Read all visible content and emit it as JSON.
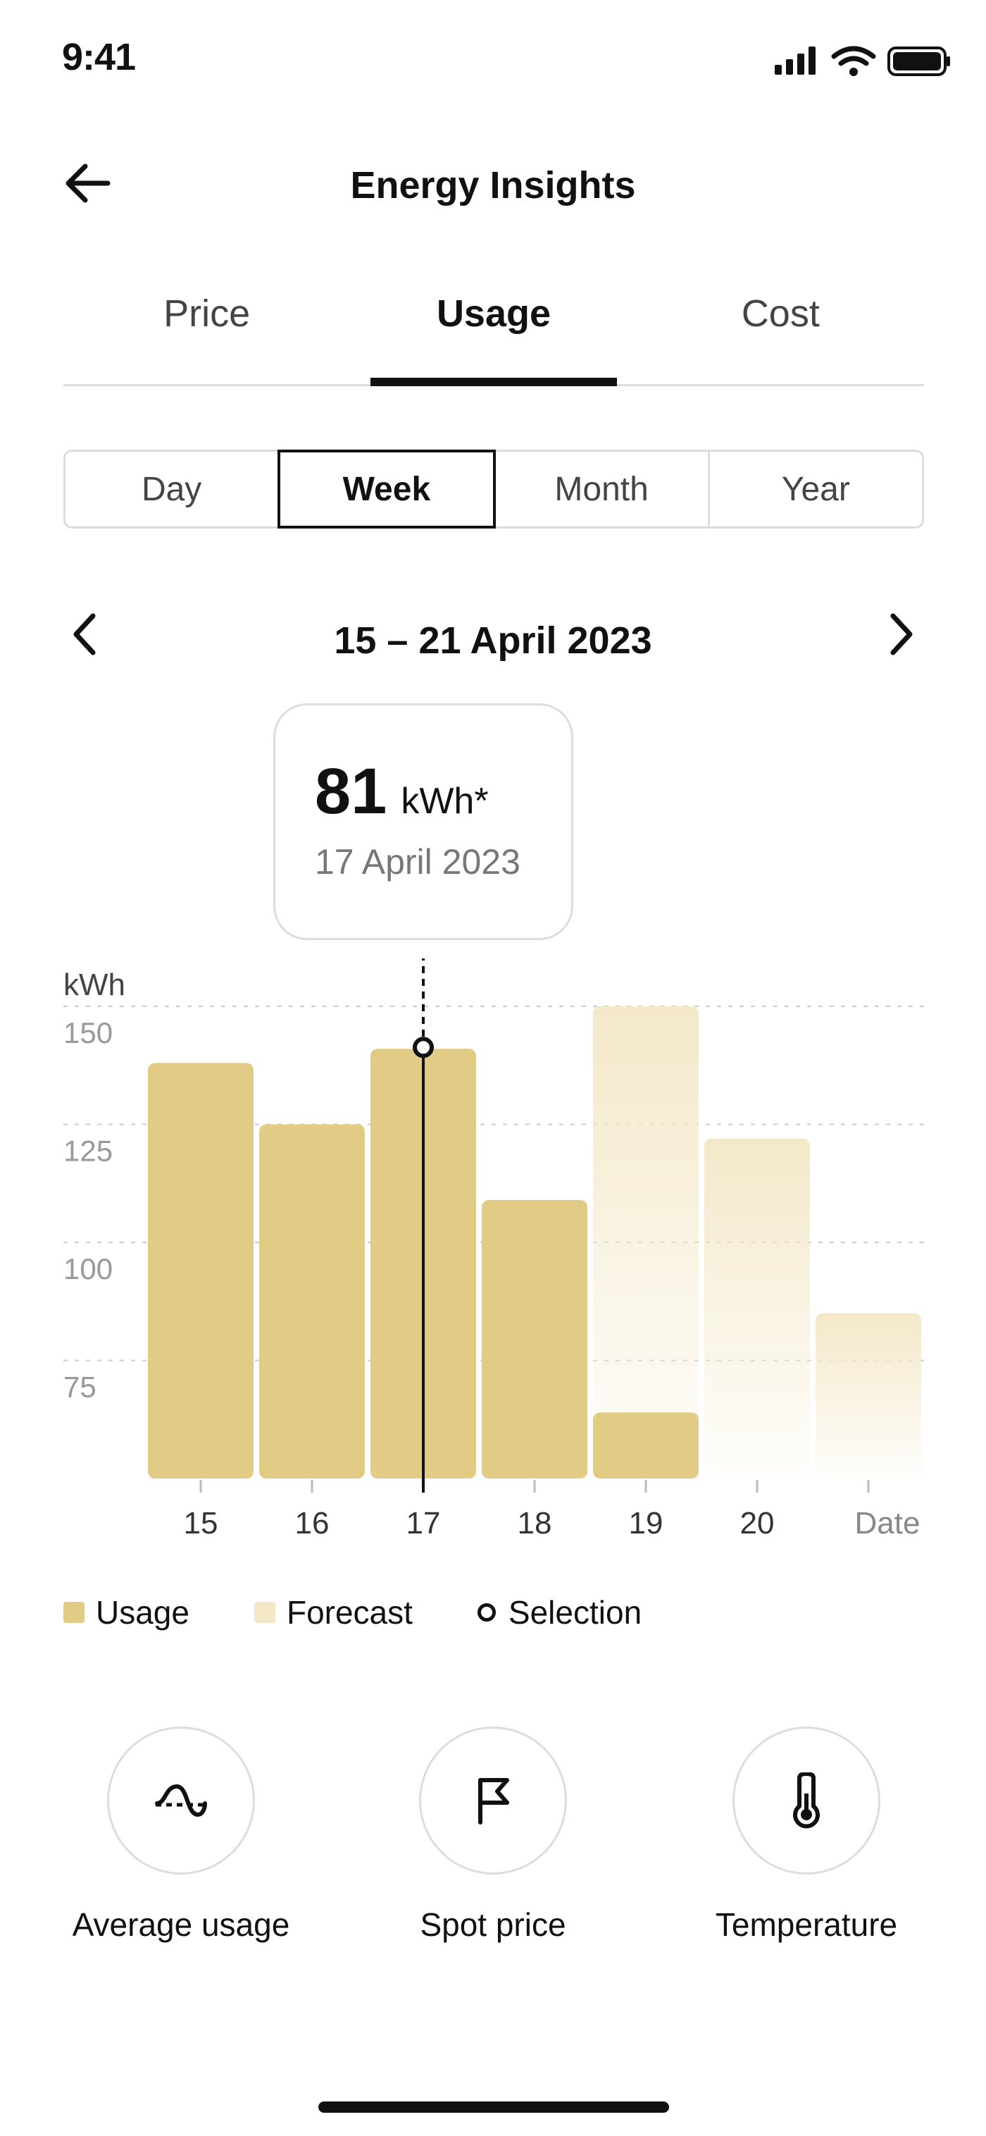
{
  "status_bar": {
    "time": "9:41"
  },
  "header": {
    "title": "Energy Insights",
    "back_icon": "arrow-left-icon"
  },
  "tabs": [
    {
      "label": "Price",
      "active": false
    },
    {
      "label": "Usage",
      "active": true
    },
    {
      "label": "Cost",
      "active": false
    }
  ],
  "period": [
    {
      "label": "Day",
      "active": false
    },
    {
      "label": "Week",
      "active": true
    },
    {
      "label": "Month",
      "active": false
    },
    {
      "label": "Year",
      "active": false
    }
  ],
  "date_nav": {
    "range": "15 – 21 April 2023",
    "prev_icon": "chevron-left-icon",
    "next_icon": "chevron-right-icon"
  },
  "tooltip": {
    "value": "81",
    "unit": "kWh*",
    "date": "17 April 2023"
  },
  "colors": {
    "usage": "#E2CB84",
    "forecast": "#F3E7C6",
    "grid": "#cccccc",
    "selection": "#111111"
  },
  "chart_data": {
    "type": "bar",
    "ylabel": "kWh",
    "xlabel": "Date",
    "categories": [
      "15",
      "16",
      "17",
      "18",
      "19",
      "20",
      ""
    ],
    "yticks": [
      75,
      125,
      100,
      150
    ],
    "ylim": [
      50,
      150
    ],
    "series": [
      {
        "name": "Usage",
        "values": [
          138,
          125,
          141,
          109,
          64,
          null,
          null
        ]
      },
      {
        "name": "Forecast",
        "values": [
          null,
          null,
          null,
          null,
          150,
          122,
          85
        ]
      }
    ],
    "selected_index": 2,
    "grid": true
  },
  "legend": {
    "usage": "Usage",
    "forecast": "Forecast",
    "selection": "Selection"
  },
  "actions": [
    {
      "label": "Average usage",
      "icon": "wave-icon"
    },
    {
      "label": "Spot price",
      "icon": "flag-icon"
    },
    {
      "label": "Temperature",
      "icon": "thermometer-icon"
    }
  ]
}
